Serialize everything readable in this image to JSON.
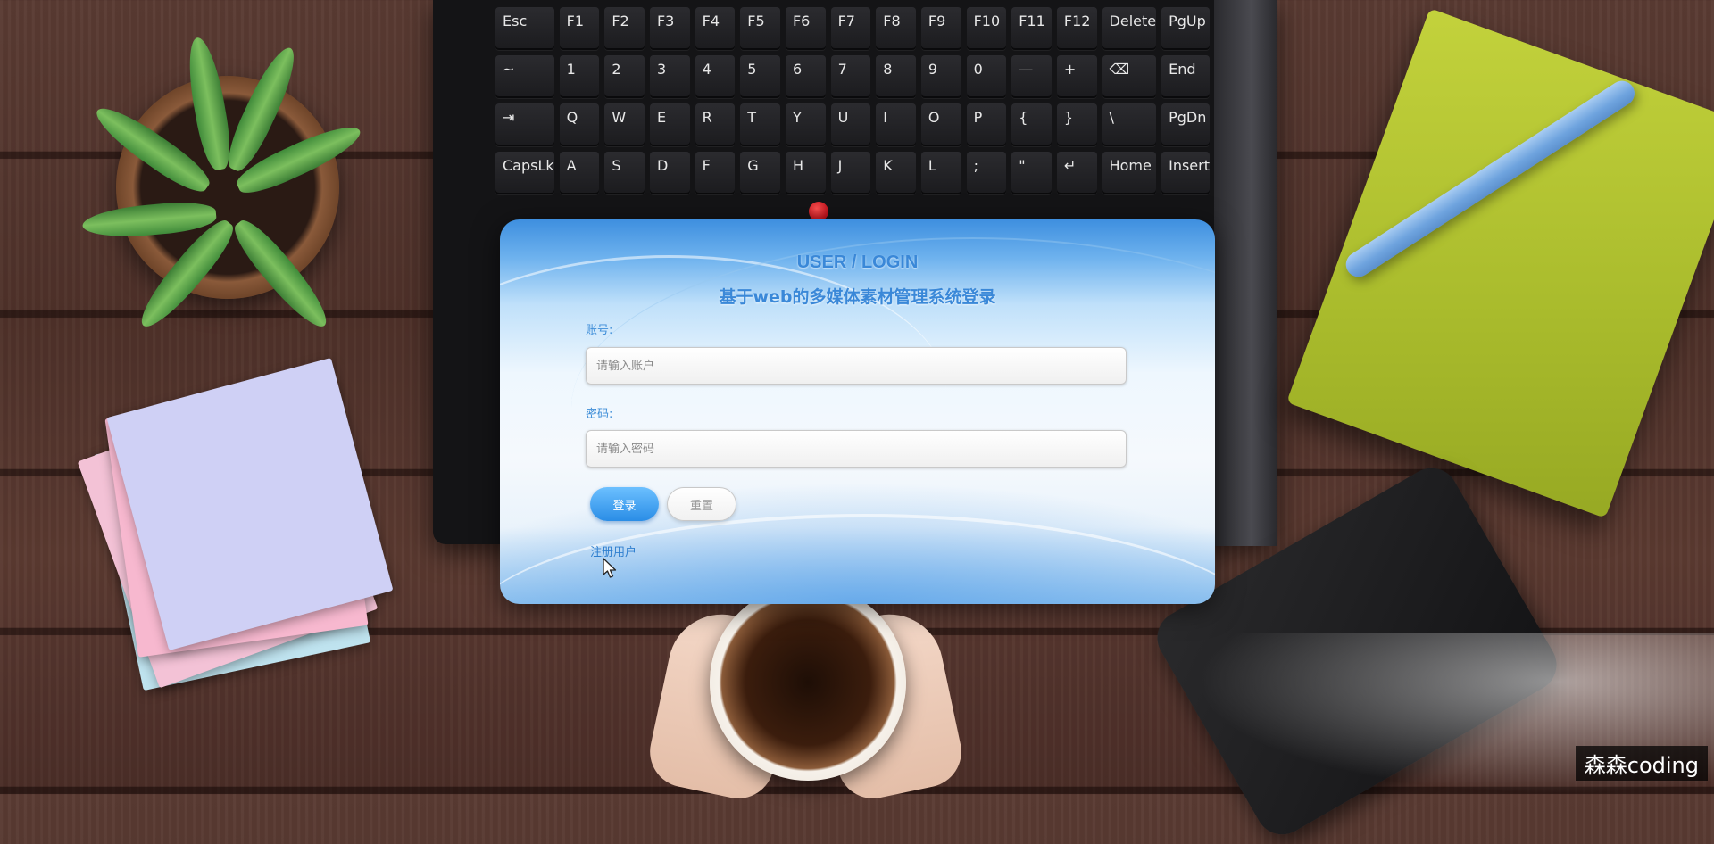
{
  "login": {
    "title": "USER / LOGIN",
    "subtitle": "基于web的多媒体素材管理系统登录",
    "account_label": "账号:",
    "account_placeholder": "请输入账户",
    "account_value": "",
    "password_label": "密码:",
    "password_placeholder": "请输入密码",
    "password_value": "",
    "login_button": "登录",
    "reset_button": "重置",
    "register_link": "注册用户"
  },
  "colors": {
    "accent": "#3a88d8",
    "login_button": "#2a8de6",
    "card_top": "#3e8fdf"
  },
  "keyboard": {
    "rows": [
      [
        "Esc",
        "F1",
        "F2",
        "F3",
        "F4",
        "F5",
        "F6",
        "F7",
        "F8",
        "F9",
        "F10",
        "F11",
        "F12",
        "Delete",
        "PgUp"
      ],
      [
        "~",
        "1",
        "2",
        "3",
        "4",
        "5",
        "6",
        "7",
        "8",
        "9",
        "0",
        "—",
        "+",
        "⌫",
        "End"
      ],
      [
        "⇥",
        "Q",
        "W",
        "E",
        "R",
        "T",
        "Y",
        "U",
        "I",
        "O",
        "P",
        "{",
        "}",
        "\\",
        "PgDn"
      ],
      [
        "CapsLk",
        "A",
        "S",
        "D",
        "F",
        "G",
        "H",
        "J",
        "K",
        "L",
        ";",
        "\"",
        "↵",
        "Home",
        "Insert"
      ]
    ]
  },
  "watermark": "森森coding"
}
